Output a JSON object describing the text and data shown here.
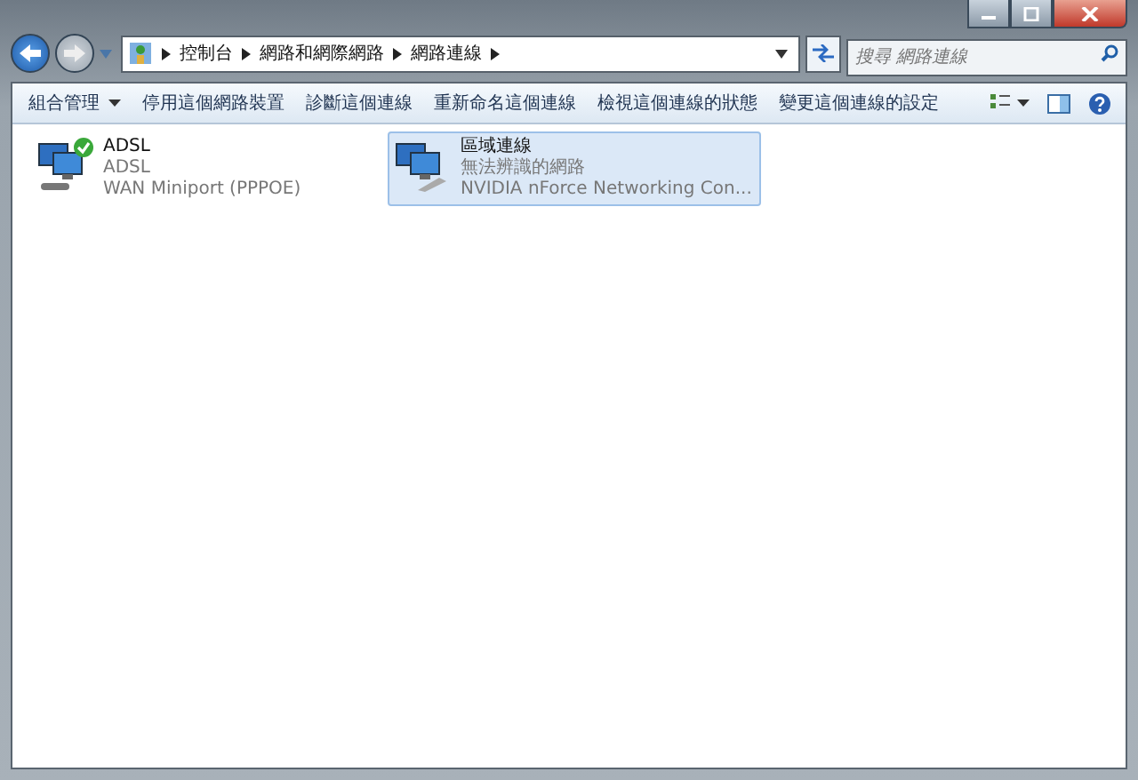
{
  "address_bar": {
    "breadcrumbs": [
      "控制台",
      "網路和網際網路",
      "網路連線"
    ]
  },
  "search": {
    "placeholder": "搜尋 網路連線"
  },
  "toolbar": {
    "items": [
      {
        "label": "組合管理",
        "dropdown": true
      },
      {
        "label": "停用這個網路裝置",
        "dropdown": false
      },
      {
        "label": "診斷這個連線",
        "dropdown": false
      },
      {
        "label": "重新命名這個連線",
        "dropdown": false
      },
      {
        "label": "檢視這個連線的狀態",
        "dropdown": false
      },
      {
        "label": "變更這個連線的設定",
        "dropdown": false
      }
    ]
  },
  "connections": [
    {
      "name": "ADSL",
      "status": "ADSL",
      "device": "WAN Miniport (PPPOE)",
      "connected": true,
      "selected": false
    },
    {
      "name": "區域連線",
      "status": "無法辨識的網路",
      "device": "NVIDIA nForce Networking Con...",
      "connected": false,
      "selected": true
    }
  ]
}
